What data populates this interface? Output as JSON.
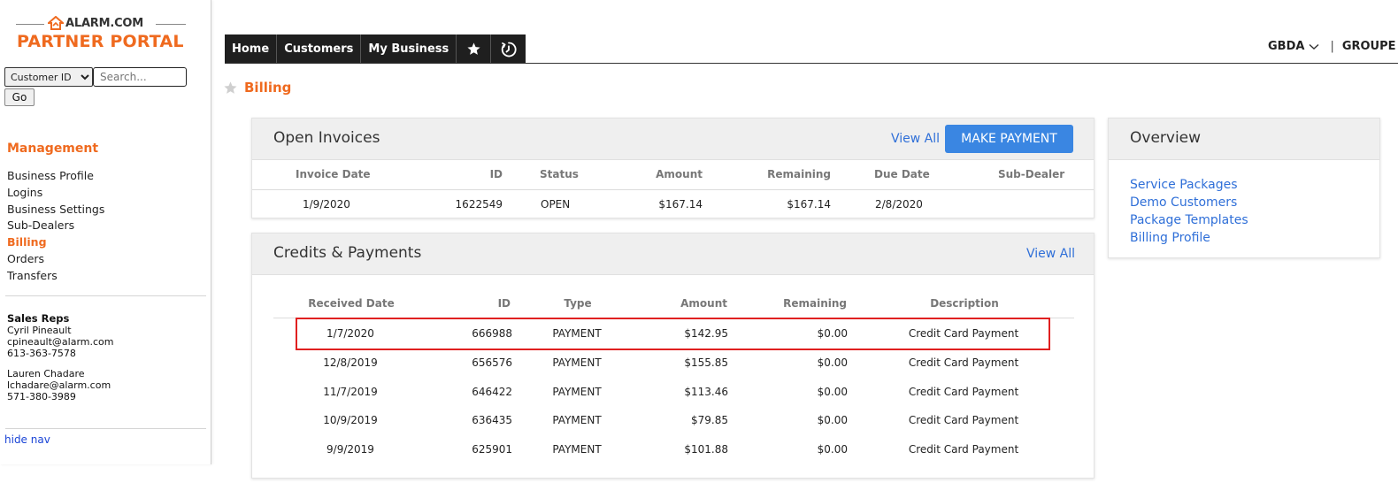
{
  "logo": {
    "brand": "ALARM.COM",
    "portal": "PARTNER PORTAL"
  },
  "search": {
    "type_selected": "Customer ID",
    "placeholder": "Search...",
    "go_label": "Go"
  },
  "sidebar": {
    "section_title": "Management",
    "items": [
      {
        "label": "Business Profile"
      },
      {
        "label": "Logins"
      },
      {
        "label": "Business Settings"
      },
      {
        "label": "Sub-Dealers"
      },
      {
        "label": "Billing"
      },
      {
        "label": "Orders"
      },
      {
        "label": "Transfers"
      }
    ],
    "active_item": "Billing",
    "reps_title": "Sales Reps",
    "reps": [
      {
        "name": "Cyril Pineault",
        "email": "cpineault@alarm.com",
        "phone": "613-363-7578"
      },
      {
        "name": "Lauren Chadare",
        "email": "lchadare@alarm.com",
        "phone": "571-380-3989"
      }
    ],
    "hide_nav": "hide nav"
  },
  "topnav": {
    "tabs": [
      {
        "label": "Home"
      },
      {
        "label": "Customers"
      },
      {
        "label": "My Business"
      }
    ],
    "icons": [
      "star-icon",
      "history-icon"
    ]
  },
  "account": {
    "dealer": "GBDA",
    "separator": "|",
    "group": "GROUPE"
  },
  "page_title": "Billing",
  "open_invoices": {
    "title": "Open Invoices",
    "view_all": "View All",
    "make_payment": "MAKE PAYMENT",
    "columns": [
      "Invoice Date",
      "ID",
      "Status",
      "Amount",
      "Remaining",
      "Due Date",
      "Sub-Dealer"
    ],
    "rows": [
      {
        "date": "1/9/2020",
        "id": "1622549",
        "status": "OPEN",
        "amount": "$167.14",
        "remaining": "$167.14",
        "due": "2/8/2020",
        "subdealer": ""
      }
    ]
  },
  "credits": {
    "title": "Credits & Payments",
    "view_all": "View All",
    "columns": [
      "Received Date",
      "ID",
      "Type",
      "Amount",
      "Remaining",
      "Description"
    ],
    "rows": [
      {
        "date": "1/7/2020",
        "id": "666988",
        "type": "PAYMENT",
        "amount": "$142.95",
        "remaining": "$0.00",
        "description": "Credit Card Payment"
      },
      {
        "date": "12/8/2019",
        "id": "656576",
        "type": "PAYMENT",
        "amount": "$155.85",
        "remaining": "$0.00",
        "description": "Credit Card Payment"
      },
      {
        "date": "11/7/2019",
        "id": "646422",
        "type": "PAYMENT",
        "amount": "$113.46",
        "remaining": "$0.00",
        "description": "Credit Card Payment"
      },
      {
        "date": "10/9/2019",
        "id": "636435",
        "type": "PAYMENT",
        "amount": "$79.85",
        "remaining": "$0.00",
        "description": "Credit Card Payment"
      },
      {
        "date": "9/9/2019",
        "id": "625901",
        "type": "PAYMENT",
        "amount": "$101.88",
        "remaining": "$0.00",
        "description": "Credit Card Payment"
      }
    ]
  },
  "overview": {
    "title": "Overview",
    "links": [
      {
        "label": "Service Packages"
      },
      {
        "label": "Demo Customers"
      },
      {
        "label": "Package Templates"
      },
      {
        "label": "Billing Profile"
      }
    ]
  },
  "colors": {
    "brand_orange": "#ef6a1f",
    "link_blue": "#2f6fd8",
    "button_blue": "#3a86e2",
    "highlight_red": "#e02020",
    "nav_dark": "#1f1f1f"
  }
}
